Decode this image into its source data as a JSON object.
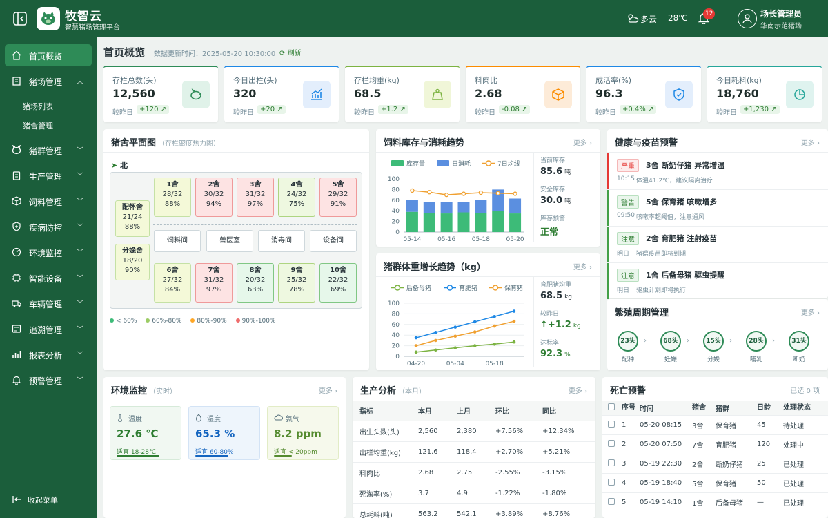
{
  "app": {
    "name": "牧智云",
    "subtitle": "智慧猪场管理平台"
  },
  "header": {
    "weather": "多云",
    "temperature": "28℃",
    "notifications": "12",
    "user_name": "场长管理员",
    "farm": "华南示范猪场"
  },
  "sidebar": {
    "items": [
      {
        "label": "首页概览"
      },
      {
        "label": "猪场管理",
        "sub": [
          "猪场列表",
          "猪舍管理"
        ]
      },
      {
        "label": "猪群管理"
      },
      {
        "label": "生产管理"
      },
      {
        "label": "饲料管理"
      },
      {
        "label": "疾病防控"
      },
      {
        "label": "环境监控"
      },
      {
        "label": "智能设备"
      },
      {
        "label": "车辆管理"
      },
      {
        "label": "追溯管理"
      },
      {
        "label": "报表分析"
      },
      {
        "label": "预警管理"
      }
    ],
    "collapse": "收起菜单"
  },
  "page": {
    "title": "首页概览",
    "update_time": "数据更新时间：2025-05-20 10:30:00",
    "refresh": "刷新"
  },
  "kpis": [
    {
      "label": "存栏总数(头)",
      "value": "12,560",
      "compare": "较昨日",
      "delta": "+120",
      "color": "#2e8b57"
    },
    {
      "label": "今日出栏(头)",
      "value": "320",
      "compare": "较昨日",
      "delta": "+20",
      "color": "#1e88e5"
    },
    {
      "label": "存栏均重(kg)",
      "value": "68.5",
      "compare": "较昨日",
      "delta": "+1.2",
      "color": "#7cb342"
    },
    {
      "label": "料肉比",
      "value": "2.68",
      "compare": "较昨日",
      "delta": "-0.08",
      "color": "#fb8c00"
    },
    {
      "label": "成活率(%)",
      "value": "96.3",
      "compare": "较昨日",
      "delta": "+0.4%",
      "color": "#1e88e5"
    },
    {
      "label": "今日耗料(kg)",
      "value": "18,760",
      "compare": "较昨日",
      "delta": "+1,230",
      "color": "#26a69a"
    }
  ],
  "floorplan": {
    "title": "猪舍平面图",
    "subtitle": "（存栏密度热力图）",
    "north": "北",
    "left_pens": [
      {
        "name": "配怀舍",
        "count": "21/24",
        "rate": "88%"
      },
      {
        "name": "分娩舍",
        "count": "18/20",
        "rate": "90%"
      }
    ],
    "top_pens": [
      {
        "name": "1舍",
        "count": "28/32",
        "rate": "88%"
      },
      {
        "name": "2舍",
        "count": "30/32",
        "rate": "94%"
      },
      {
        "name": "3舍",
        "count": "31/32",
        "rate": "97%"
      },
      {
        "name": "4舍",
        "count": "24/32",
        "rate": "75%"
      },
      {
        "name": "5舍",
        "count": "29/32",
        "rate": "91%"
      }
    ],
    "rooms": [
      "饲料间",
      "兽医室",
      "消毒间",
      "设备间"
    ],
    "bottom_pens": [
      {
        "name": "6舍",
        "count": "27/32",
        "rate": "84%"
      },
      {
        "name": "7舍",
        "count": "31/32",
        "rate": "97%"
      },
      {
        "name": "8舍",
        "count": "20/32",
        "rate": "63%"
      },
      {
        "name": "9舍",
        "count": "25/32",
        "rate": "78%"
      },
      {
        "name": "10舍",
        "count": "22/32",
        "rate": "69%"
      }
    ],
    "legend": [
      "< 60%",
      "60%-80%",
      "80%-90%",
      "90%-100%"
    ]
  },
  "feed": {
    "title": "饲料库存与消耗趋势",
    "more": "更多",
    "stock_label": "当前库存",
    "stock": "85.6",
    "safe_label": "安全库存",
    "safe": "30.0",
    "unit": "吨",
    "warn_label": "库存预警",
    "warn": "正常"
  },
  "weight": {
    "title": "猪群体重增长趋势（kg）",
    "more": "更多",
    "avg_label": "育肥猪均重",
    "avg": "68.5",
    "cmp_label": "较昨日",
    "cmp": "+1.2",
    "rate_label": "达标率",
    "rate": "92.3",
    "unit_kg": "kg",
    "unit_pct": "%"
  },
  "health": {
    "title": "健康与疫苗预警",
    "more": "更多",
    "alerts": [
      {
        "tag": "严重",
        "title": "3舍 断奶仔猪 异常增温",
        "time": "10:15",
        "desc": "体温41.2℃，建议隔离治疗"
      },
      {
        "tag": "警告",
        "title": "5舍 保育猪 咳嗽增多",
        "time": "09:50",
        "desc": "咳嗽率超阈值，注意通风"
      },
      {
        "tag": "注意",
        "title": "2舍 育肥猪 注射疫苗",
        "time": "明日",
        "desc": "猪瘟疫苗即将到期"
      },
      {
        "tag": "注意",
        "title": "1舍 后备母猪 驱虫提醒",
        "time": "明日",
        "desc": "驱虫计划即将执行"
      }
    ]
  },
  "breeding": {
    "title": "繁殖周期管理",
    "more": "更多",
    "stages": [
      {
        "count": "23头",
        "label": "配种"
      },
      {
        "count": "68头",
        "label": "妊娠"
      },
      {
        "count": "15头",
        "label": "分娩"
      },
      {
        "count": "28头",
        "label": "哺乳"
      },
      {
        "count": "31头",
        "label": "断奶"
      }
    ]
  },
  "env": {
    "title": "环境监控",
    "subtitle": "（实时）",
    "more": "更多",
    "items": [
      {
        "label": "温度",
        "value": "27.6 ℃",
        "range": "适宜 18-28℃",
        "color": "#2e7d32"
      },
      {
        "label": "湿度",
        "value": "65.3 %",
        "range": "适宜 60-80%",
        "color": "#1565c0"
      },
      {
        "label": "氨气",
        "value": "8.2 ppm",
        "range": "适宜 < 20ppm",
        "color": "#558b2f"
      }
    ]
  },
  "production": {
    "title": "生产分析",
    "subtitle": "（本月）",
    "more": "更多",
    "headers": [
      "指标",
      "本月",
      "上月",
      "环比",
      "同比"
    ],
    "rows": [
      [
        "出生头数(头)",
        "2,560",
        "2,380",
        "+7.56%",
        "+12.34%"
      ],
      [
        "出栏均重(kg)",
        "121.6",
        "118.4",
        "+2.70%",
        "+5.21%"
      ],
      [
        "料肉比",
        "2.68",
        "2.75",
        "-2.55%",
        "-3.15%"
      ],
      [
        "死淘率(%)",
        "3.7",
        "4.9",
        "-1.22%",
        "-1.80%"
      ],
      [
        "总耗料(吨)",
        "563.2",
        "542.1",
        "+3.89%",
        "+8.76%"
      ]
    ]
  },
  "death": {
    "title": "死亡预警",
    "selected": "已选 0 项",
    "headers": [
      "序号",
      "时间",
      "猪舍",
      "猪群",
      "日龄",
      "处理状态"
    ],
    "rows": [
      [
        "1",
        "05-20 08:15",
        "3舍",
        "保育猪",
        "45",
        "待处理"
      ],
      [
        "2",
        "05-20 07:50",
        "7舍",
        "育肥猪",
        "120",
        "处理中"
      ],
      [
        "3",
        "05-19 22:30",
        "2舍",
        "断奶仔猪",
        "25",
        "已处理"
      ],
      [
        "4",
        "05-19 18:40",
        "5舍",
        "保育猪",
        "50",
        "已处理"
      ],
      [
        "5",
        "05-19 14:10",
        "1舍",
        "后备母猪",
        "—",
        "已处理"
      ]
    ]
  },
  "chart_data": [
    {
      "type": "bar",
      "categories": [
        "05-14",
        "05-15",
        "05-16",
        "05-17",
        "05-18",
        "05-19",
        "05-20"
      ],
      "x_tick_labels": [
        "05-14",
        "05-16",
        "05-18",
        "05-20"
      ],
      "series": [
        {
          "name": "库存量",
          "values": [
            38,
            36,
            35,
            37,
            36,
            39,
            35
          ],
          "color": "#3dbb78"
        },
        {
          "name": "日消耗",
          "values": [
            22,
            20,
            21,
            19,
            25,
            41,
            28
          ],
          "color": "#5b8fe0"
        },
        {
          "name": "7日均线",
          "values": [
            78,
            75,
            70,
            72,
            74,
            73,
            72
          ],
          "color": "#f0a030"
        }
      ],
      "stacked": true,
      "ylim": [
        0,
        100
      ],
      "yticks": [
        0,
        20,
        40,
        60,
        80,
        100
      ],
      "legend": "top"
    },
    {
      "type": "line",
      "x": [
        "04-20",
        "04-27",
        "05-04",
        "05-11",
        "05-18",
        "05-25"
      ],
      "x_tick_labels": [
        "04-20",
        "05-04",
        "05-18"
      ],
      "series": [
        {
          "name": "后备母猪",
          "values": [
            8,
            12,
            16,
            20,
            23,
            27
          ],
          "color": "#7cb342"
        },
        {
          "name": "育肥猪",
          "values": [
            35,
            45,
            55,
            65,
            75,
            85
          ],
          "color": "#1e88e5"
        },
        {
          "name": "保育猪",
          "values": [
            20,
            30,
            38,
            46,
            57,
            66
          ],
          "color": "#f0a030"
        }
      ],
      "ylim": [
        0,
        100
      ],
      "yticks": [
        0,
        20,
        40,
        60,
        80,
        100
      ],
      "legend": "top"
    }
  ]
}
